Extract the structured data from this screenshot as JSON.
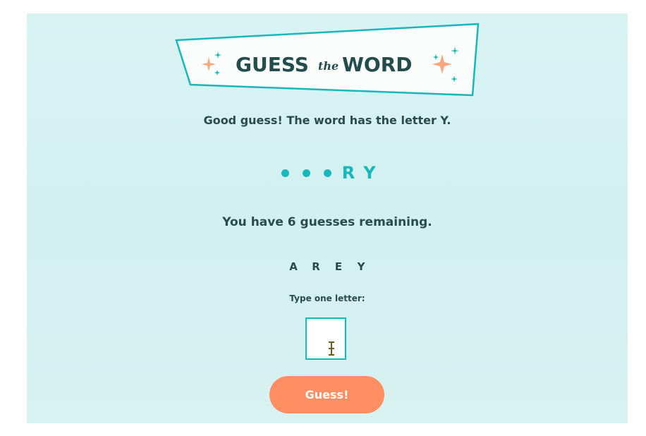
{
  "banner": {
    "title_guess": "GUESS",
    "title_the": "the",
    "title_word": "WORD"
  },
  "status_message": "Good guess! The word has the letter Y.",
  "word_slots": [
    "",
    "",
    "",
    "R",
    "Y"
  ],
  "remaining_text": "You have 6 guesses remaining.",
  "guessed_letters": [
    "A",
    "R",
    "E",
    "Y"
  ],
  "input": {
    "label": "Type one letter:",
    "value": ""
  },
  "guess_button_label": "Guess!",
  "colors": {
    "background": "#d4f1f1",
    "accent_teal": "#17b7bb",
    "text_dark": "#2b4a4d",
    "button_orange": "#ff8f62",
    "sparkle_orange": "#f6a77e"
  }
}
